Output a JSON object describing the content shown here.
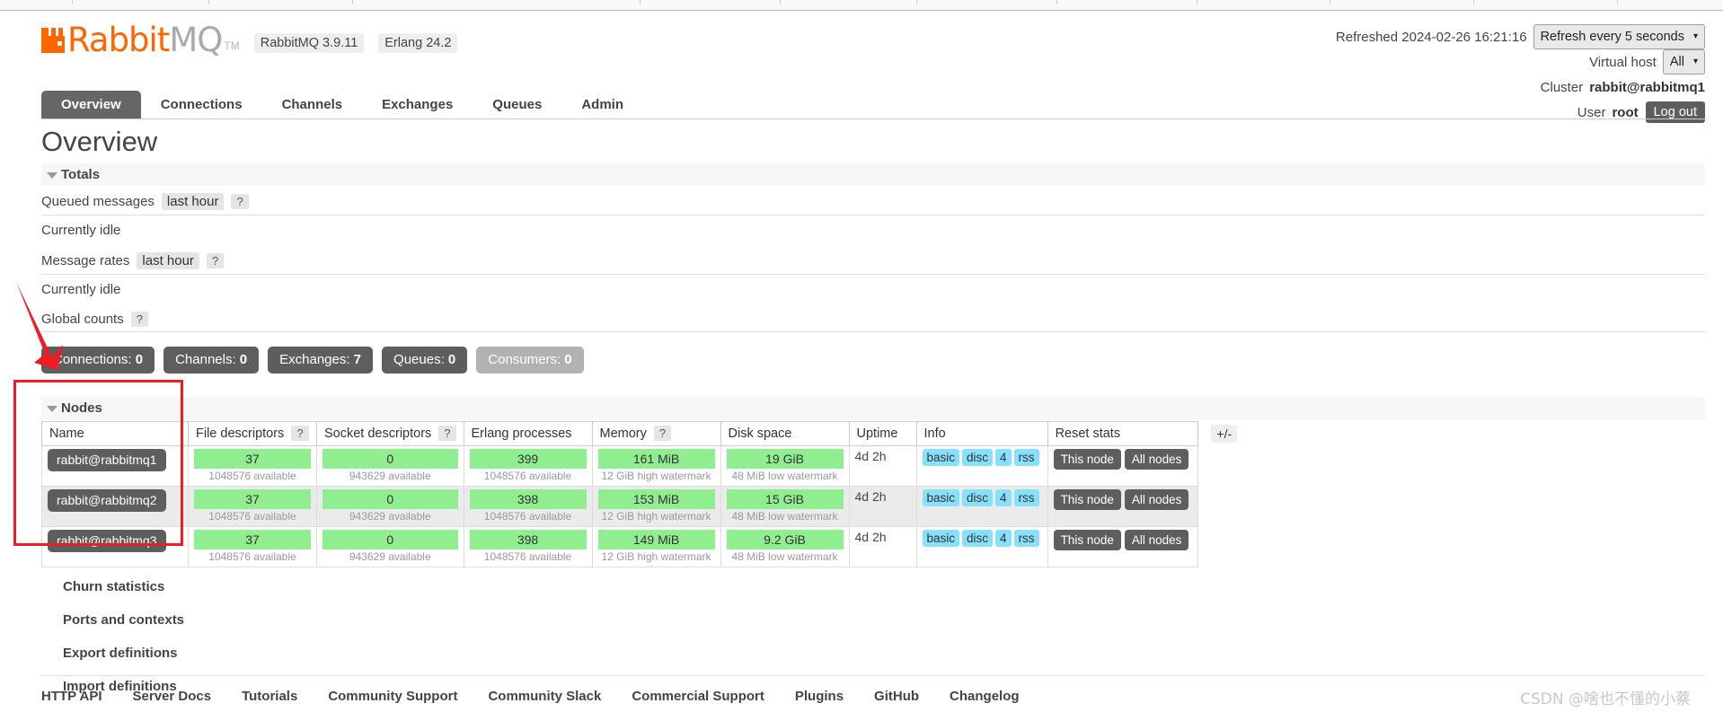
{
  "brand": {
    "name_part1": "Rabbit",
    "name_part2": "MQ",
    "tm": "TM",
    "rabbitmq_version": "RabbitMQ 3.9.11",
    "erlang_version": "Erlang 24.2",
    "accent_color": "#ff6600"
  },
  "header": {
    "refreshed_label": "Refreshed 2024-02-26 16:21:16",
    "refresh_select_value": "Refresh every 5 seconds",
    "vhost_label": "Virtual host",
    "vhost_select_value": "All",
    "cluster_label": "Cluster",
    "cluster_value": "rabbit@rabbitmq1",
    "user_label": "User",
    "user_value": "root",
    "logout_label": "Log out"
  },
  "nav": {
    "tabs": [
      {
        "label": "Overview",
        "active": true
      },
      {
        "label": "Connections",
        "active": false
      },
      {
        "label": "Channels",
        "active": false
      },
      {
        "label": "Exchanges",
        "active": false
      },
      {
        "label": "Queues",
        "active": false
      },
      {
        "label": "Admin",
        "active": false
      }
    ]
  },
  "page": {
    "title": "Overview"
  },
  "totals": {
    "section_label": "Totals",
    "queued_messages_label": "Queued messages",
    "queued_messages_period": "last hour",
    "queued_messages_idle": "Currently idle",
    "message_rates_label": "Message rates",
    "message_rates_period": "last hour",
    "message_rates_idle": "Currently idle",
    "global_counts_label": "Global counts",
    "help_glyph": "?",
    "counts": [
      {
        "label": "Connections:",
        "value": "0",
        "muted": false
      },
      {
        "label": "Channels:",
        "value": "0",
        "muted": false
      },
      {
        "label": "Exchanges:",
        "value": "7",
        "muted": false
      },
      {
        "label": "Queues:",
        "value": "0",
        "muted": false
      },
      {
        "label": "Consumers:",
        "value": "0",
        "muted": true
      }
    ]
  },
  "nodes": {
    "section_label": "Nodes",
    "plus_minus_label": "+/-",
    "columns": [
      "Name",
      "File descriptors",
      "Socket descriptors",
      "Erlang processes",
      "Memory",
      "Disk space",
      "Uptime",
      "Info",
      "Reset stats"
    ],
    "columns_with_help": [
      "File descriptors",
      "Socket descriptors",
      "Memory"
    ],
    "rows": [
      {
        "name": "rabbit@rabbitmq1",
        "file_descriptors": "37",
        "file_descriptors_sub": "1048576 available",
        "socket_descriptors": "0",
        "socket_descriptors_sub": "943629 available",
        "erlang_processes": "399",
        "erlang_processes_sub": "1048576 available",
        "memory": "161 MiB",
        "memory_sub": "12 GiB high watermark",
        "disk_space": "19 GiB",
        "disk_space_sub": "48 MiB low watermark",
        "uptime": "4d 2h",
        "info": [
          "basic",
          "disc",
          "4",
          "rss"
        ],
        "reset": [
          "This node",
          "All nodes"
        ]
      },
      {
        "name": "rabbit@rabbitmq2",
        "file_descriptors": "37",
        "file_descriptors_sub": "1048576 available",
        "socket_descriptors": "0",
        "socket_descriptors_sub": "943629 available",
        "erlang_processes": "398",
        "erlang_processes_sub": "1048576 available",
        "memory": "153 MiB",
        "memory_sub": "12 GiB high watermark",
        "disk_space": "15 GiB",
        "disk_space_sub": "48 MiB low watermark",
        "uptime": "4d 2h",
        "info": [
          "basic",
          "disc",
          "4",
          "rss"
        ],
        "reset": [
          "This node",
          "All nodes"
        ]
      },
      {
        "name": "rabbit@rabbitmq3",
        "file_descriptors": "37",
        "file_descriptors_sub": "1048576 available",
        "socket_descriptors": "0",
        "socket_descriptors_sub": "943629 available",
        "erlang_processes": "398",
        "erlang_processes_sub": "1048576 available",
        "memory": "149 MiB",
        "memory_sub": "12 GiB high watermark",
        "disk_space": "9.2 GiB",
        "disk_space_sub": "48 MiB low watermark",
        "uptime": "4d 2h",
        "info": [
          "basic",
          "disc",
          "4",
          "rss"
        ],
        "reset": [
          "This node",
          "All nodes"
        ]
      }
    ]
  },
  "collapsed_sections": [
    {
      "label": "Churn statistics"
    },
    {
      "label": "Ports and contexts"
    },
    {
      "label": "Export definitions"
    },
    {
      "label": "Import definitions"
    }
  ],
  "footer": {
    "links": [
      "HTTP API",
      "Server Docs",
      "Tutorials",
      "Community Support",
      "Community Slack",
      "Commercial Support",
      "Plugins",
      "GitHub",
      "Changelog"
    ]
  },
  "watermark": {
    "text": "CSDN @啥也不懂的小蔡"
  },
  "annotations": {
    "highlight_color": "#ee1c25"
  }
}
